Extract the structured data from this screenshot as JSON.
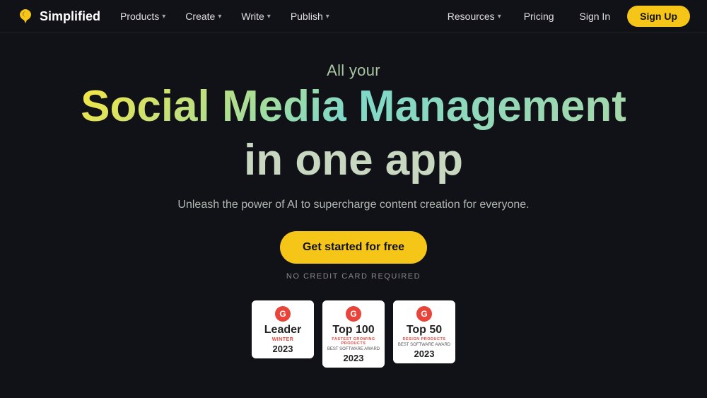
{
  "brand": {
    "name": "Simplified",
    "icon": "S"
  },
  "nav": {
    "items": [
      {
        "label": "Products",
        "hasDropdown": true
      },
      {
        "label": "Create",
        "hasDropdown": true
      },
      {
        "label": "Write",
        "hasDropdown": true
      },
      {
        "label": "Publish",
        "hasDropdown": true
      },
      {
        "label": "Resources",
        "hasDropdown": true
      },
      {
        "label": "Pricing",
        "hasDropdown": false
      }
    ],
    "signin_label": "Sign In",
    "signup_label": "Sign Up"
  },
  "hero": {
    "line1": "All your",
    "line2": "Social Media Management",
    "line3": "in one app",
    "description": "Unleash the power of AI to supercharge content creation for everyone.",
    "cta": "Get started for free",
    "no_cc": "NO CREDIT CARD REQUIRED"
  },
  "badges": [
    {
      "title": "Leader",
      "sub": "WINTER",
      "year": "2023",
      "desc": ""
    },
    {
      "title": "Top 100",
      "sub": "Fastest Growing Products",
      "year": "2023",
      "desc": "BEST SOFTWARE AWARD"
    },
    {
      "title": "Top 50",
      "sub": "Design Products",
      "year": "2023",
      "desc": "BEST SOFTWARE AWARD"
    }
  ],
  "colors": {
    "cta_bg": "#f5c518",
    "brand_accent": "#f5c518",
    "badge_red": "#e8443a"
  }
}
